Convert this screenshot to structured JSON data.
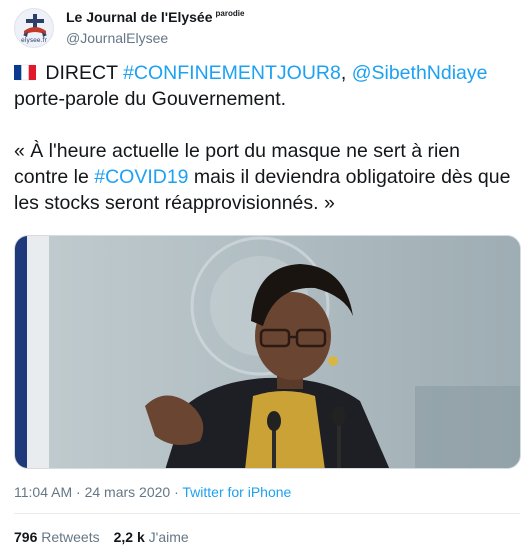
{
  "author": {
    "display_name": "Le Journal de l'Elysée",
    "badge": "parodie",
    "handle": "@JournalElysee",
    "avatar_text": "elysee.fr"
  },
  "tweet": {
    "flag_icon": "france-flag-icon",
    "line1_prefix": " DIRECT ",
    "hashtag1": "#CONFINEMENTJOUR8",
    "comma": ", ",
    "mention": "@SibethNdiaye",
    "line1_suffix": " porte-parole du Gouvernement.",
    "quote_start": "« À l'heure actuelle le port du masque ne sert à rien contre le ",
    "hashtag2": "#COVID19",
    "quote_end": " mais il deviendra obligatoire dès que les stocks seront réapprovisionnés. »"
  },
  "media": {
    "description": "photo of a spokesperson speaking at a podium"
  },
  "meta": {
    "time": "11:04 AM",
    "separator": " · ",
    "date": "24 mars 2020",
    "source": "Twitter for iPhone"
  },
  "stats": {
    "retweets_count": "796",
    "retweets_label": "Retweets",
    "likes_count": "2,2 k",
    "likes_label": "J'aime"
  },
  "colors": {
    "link": "#1da1f2",
    "secondary": "#657786",
    "text": "#14171a"
  }
}
